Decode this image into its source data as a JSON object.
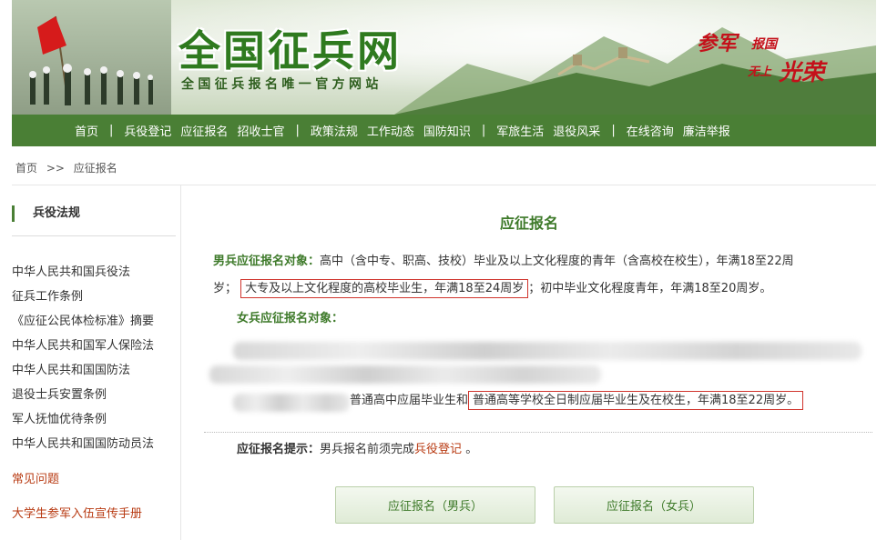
{
  "header": {
    "logo": "全国征兵网",
    "subtitle": "全国征兵报名唯一官方网站",
    "motto": [
      "参军",
      "报国",
      "无上",
      "光荣"
    ]
  },
  "nav": [
    "首页",
    "兵役登记",
    "应征报名",
    "招收士官",
    "政策法规",
    "工作动态",
    "国防知识",
    "军旅生活",
    "退役风采",
    "在线咨询",
    "廉洁举报"
  ],
  "breadcrumb": {
    "home": "首页",
    "sep": ">>",
    "current": "应征报名"
  },
  "sidebar": {
    "title": "兵役法规",
    "items": [
      "中华人民共和国兵役法",
      "征兵工作条例",
      "《应征公民体检标准》摘要",
      "中华人民共和国军人保险法",
      "中华人民共和国国防法",
      "退役士兵安置条例",
      "军人抚恤优待条例",
      "中华人民共和国国防动员法"
    ],
    "faq": "常见问题",
    "manual": "大学生参军入伍宣传手册"
  },
  "main": {
    "title": "应征报名",
    "male_label": "男兵应征报名对象：",
    "male_text_1": "高中（含中专、职高、技校）毕业及以上文化程度的青年（含高校在校生），年满18至22周",
    "male_text_2": "岁；",
    "male_highlight": "大专及以上文化程度的高校毕业生，年满18至24周岁",
    "male_text_3": "；初中毕业文化程度青年，年满18至20周岁。",
    "female_label": "女兵应征报名对象：",
    "female_text": "普通高中应届毕业生和",
    "female_highlight": "普通高等学校全日制应届毕业生及在校生，年满18至22周岁。",
    "tip_label": "应征报名提示：",
    "tip_text": "男兵报名前须完成",
    "tip_link": "兵役登记",
    "tip_end": "。",
    "btn_male": "应征报名（男兵）",
    "btn_female": "应征报名（女兵）"
  },
  "colors": {
    "brand_green": "#4a7f35",
    "title_green": "#3e7a2a",
    "link_red": "#b83a12",
    "highlight_border": "#d0342c"
  }
}
